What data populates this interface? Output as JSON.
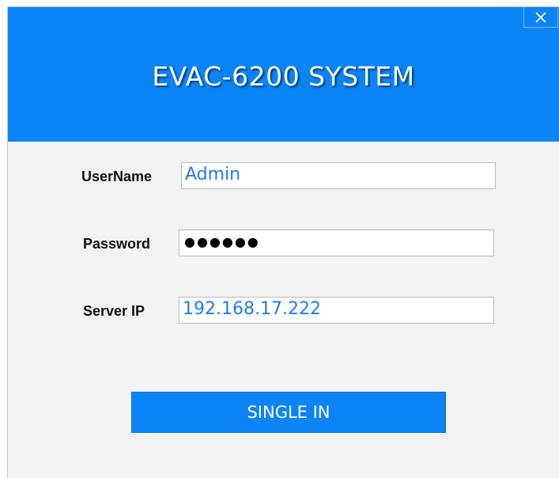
{
  "window": {
    "title": "EVAC-6200 SYSTEM",
    "close_icon": "close-x-icon"
  },
  "form": {
    "username": {
      "label": "UserName",
      "value": "Admin"
    },
    "password": {
      "label": "Password",
      "masked_value": "●●●●●●"
    },
    "server_ip": {
      "label": "Server IP",
      "value": "192.168.17.222"
    }
  },
  "actions": {
    "submit_label": "SINGLE IN"
  },
  "colors": {
    "accent": "#0b84f7",
    "field_text": "#1f7de6",
    "background": "#f3f3f3"
  }
}
